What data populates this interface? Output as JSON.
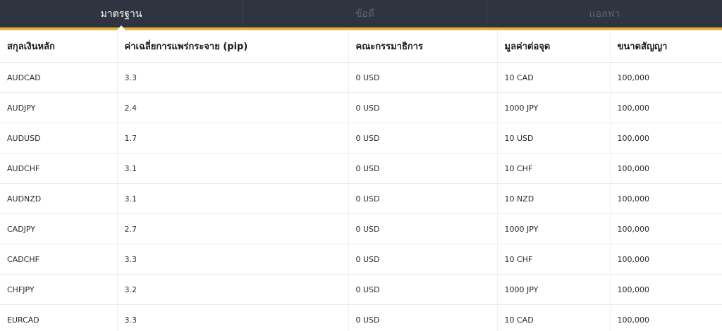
{
  "tabs": [
    {
      "label": "มาตรฐาน",
      "active": true
    },
    {
      "label": "ข้อดี",
      "active": false
    },
    {
      "label": "แอลฟา",
      "active": false
    }
  ],
  "colors": {
    "tabbar_bg": "#2f3440",
    "accent_line": "#e8b33b",
    "inactive_tab_text": "#5c6270",
    "active_tab_text": "#ffffff"
  },
  "table": {
    "headers": [
      "สกุลเงินหลัก",
      "ค่าเฉลี่ยการแพร่กระจาย (pip)",
      "คณะกรรมาธิการ",
      "มูลค่าต่อจุด",
      "ขนาดสัญญา"
    ],
    "rows": [
      [
        "AUDCAD",
        "3.3",
        "0 USD",
        "10 CAD",
        "100,000"
      ],
      [
        "AUDJPY",
        "2.4",
        "0 USD",
        "1000 JPY",
        "100,000"
      ],
      [
        "AUDUSD",
        "1.7",
        "0 USD",
        "10 USD",
        "100,000"
      ],
      [
        "AUDCHF",
        "3.1",
        "0 USD",
        "10 CHF",
        "100,000"
      ],
      [
        "AUDNZD",
        "3.1",
        "0 USD",
        "10 NZD",
        "100,000"
      ],
      [
        "CADJPY",
        "2.7",
        "0 USD",
        "1000 JPY",
        "100,000"
      ],
      [
        "CADCHF",
        "3.3",
        "0 USD",
        "10 CHF",
        "100,000"
      ],
      [
        "CHFJPY",
        "3.2",
        "0 USD",
        "1000 JPY",
        "100,000"
      ],
      [
        "EURCAD",
        "3.3",
        "0 USD",
        "10 CAD",
        "100,000"
      ]
    ]
  }
}
